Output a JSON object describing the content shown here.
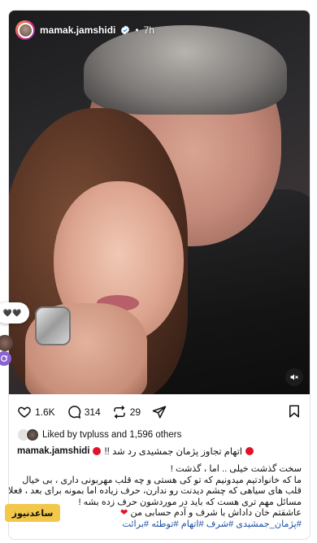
{
  "post": {
    "username": "mamak.jamshidi",
    "dot": "•",
    "time": "7h"
  },
  "side_overlay": {
    "hearts": "🖤🖤"
  },
  "actions": {
    "likes_count": "1.6K",
    "comments_count": "314",
    "reposts_count": "29"
  },
  "liked_by": {
    "text": "Liked by tvpluss and 1,596 others"
  },
  "caption": {
    "username": "mamak.jamshidi",
    "headline": "اتهام تجاوز پژمان جمشیدی رد شد !!",
    "lines": [
      "سخت گذشت خیلی .. اما ، گذشت !",
      "ما که خانوادتیم میدونیم که تو کی هستی و چه قلب مهربونی داری ، بی خیال",
      "قلب های سیاهی که چشم دیدنت رو ندارن، حرف زیاده اما بمونه برای بعد ، فعلا",
      "مسائل مهم تری هست که باید در موردشون حرف زده بشه !",
      "عاشقتم خان داداش با شرف و آدم حسابی من"
    ],
    "heart": "❤",
    "hashtags": "#پژمان_جمشیدی #شرف #اتهام #توطئه #برائت"
  },
  "watermark": {
    "text": "ساعدنیوز"
  },
  "colors": {
    "accent_red": "#e0132a",
    "hashtag_blue": "#1f4fa3",
    "verified_blue": "#0095f6",
    "watermark_yellow": "#f2c74a"
  },
  "icons": [
    "verified-icon",
    "mute-icon",
    "heart-icon",
    "comment-icon",
    "repost-icon",
    "share-icon",
    "bookmark-icon"
  ]
}
